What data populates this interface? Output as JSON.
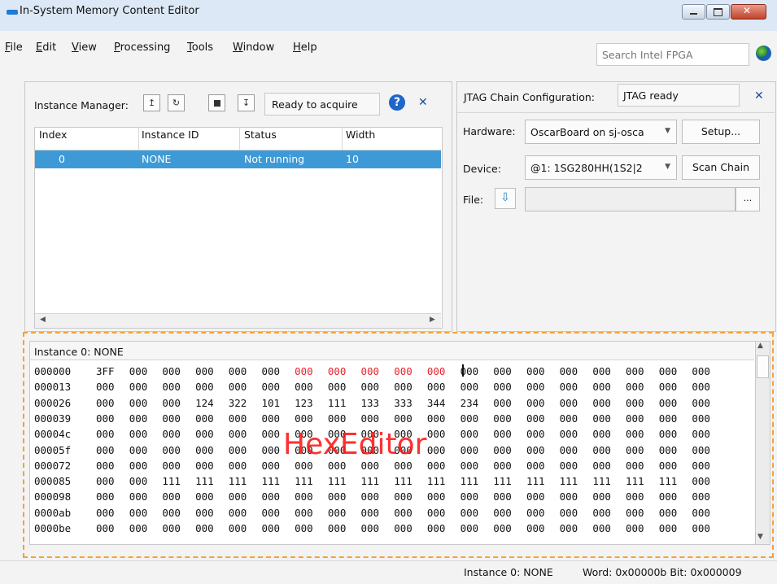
{
  "window": {
    "title": "In-System Memory Content Editor"
  },
  "menu": [
    "File",
    "Edit",
    "View",
    "Processing",
    "Tools",
    "Window",
    "Help"
  ],
  "search": {
    "placeholder": "Search Intel FPGA"
  },
  "instance_manager": {
    "label": "Instance Manager:",
    "status": "Ready to acquire",
    "help_glyph": "?",
    "close_glyph": "✕",
    "columns": [
      "Index",
      "Instance ID",
      "Status",
      "Width"
    ],
    "rows": [
      {
        "index": "0",
        "instance_id": "NONE",
        "status": "Not running",
        "width": "10"
      }
    ]
  },
  "jtag": {
    "label": "JTAG Chain Configuration:",
    "status": "JTAG ready",
    "close_glyph": "✕",
    "hardware_label": "Hardware:",
    "hardware_value": "OscarBoard on sj-osca",
    "setup_label": "Setup...",
    "device_label": "Device:",
    "device_value": "@1: 1SG280HH(1S2|2",
    "scan_chain_label": "Scan Chain",
    "file_label": "File:",
    "browse_label": "..."
  },
  "hex_editor": {
    "title": "Instance 0: NONE",
    "overlay_label": "HexEditor",
    "rows": [
      {
        "addr": "000000",
        "values": [
          "3FF",
          "000",
          "000",
          "000",
          "000",
          "000",
          "000",
          "000",
          "000",
          "000",
          "000",
          "000",
          "000",
          "000",
          "000",
          "000",
          "000",
          "000",
          "000"
        ],
        "highlight": [
          6,
          7,
          8,
          9,
          10
        ]
      },
      {
        "addr": "000013",
        "values": [
          "000",
          "000",
          "000",
          "000",
          "000",
          "000",
          "000",
          "000",
          "000",
          "000",
          "000",
          "000",
          "000",
          "000",
          "000",
          "000",
          "000",
          "000",
          "000"
        ],
        "highlight": []
      },
      {
        "addr": "000026",
        "values": [
          "000",
          "000",
          "000",
          "124",
          "322",
          "101",
          "123",
          "111",
          "133",
          "333",
          "344",
          "234",
          "000",
          "000",
          "000",
          "000",
          "000",
          "000",
          "000"
        ],
        "highlight": []
      },
      {
        "addr": "000039",
        "values": [
          "000",
          "000",
          "000",
          "000",
          "000",
          "000",
          "000",
          "000",
          "000",
          "000",
          "000",
          "000",
          "000",
          "000",
          "000",
          "000",
          "000",
          "000",
          "000"
        ],
        "highlight": []
      },
      {
        "addr": "00004c",
        "values": [
          "000",
          "000",
          "000",
          "000",
          "000",
          "000",
          "000",
          "000",
          "000",
          "000",
          "000",
          "000",
          "000",
          "000",
          "000",
          "000",
          "000",
          "000",
          "000"
        ],
        "highlight": []
      },
      {
        "addr": "00005f",
        "values": [
          "000",
          "000",
          "000",
          "000",
          "000",
          "000",
          "000",
          "000",
          "000",
          "000",
          "000",
          "000",
          "000",
          "000",
          "000",
          "000",
          "000",
          "000",
          "000"
        ],
        "highlight": []
      },
      {
        "addr": "000072",
        "values": [
          "000",
          "000",
          "000",
          "000",
          "000",
          "000",
          "000",
          "000",
          "000",
          "000",
          "000",
          "000",
          "000",
          "000",
          "000",
          "000",
          "000",
          "000",
          "000"
        ],
        "highlight": []
      },
      {
        "addr": "000085",
        "values": [
          "000",
          "000",
          "111",
          "111",
          "111",
          "111",
          "111",
          "111",
          "111",
          "111",
          "111",
          "111",
          "111",
          "111",
          "111",
          "111",
          "111",
          "111",
          "000"
        ],
        "highlight": []
      },
      {
        "addr": "000098",
        "values": [
          "000",
          "000",
          "000",
          "000",
          "000",
          "000",
          "000",
          "000",
          "000",
          "000",
          "000",
          "000",
          "000",
          "000",
          "000",
          "000",
          "000",
          "000",
          "000"
        ],
        "highlight": []
      },
      {
        "addr": "0000ab",
        "values": [
          "000",
          "000",
          "000",
          "000",
          "000",
          "000",
          "000",
          "000",
          "000",
          "000",
          "000",
          "000",
          "000",
          "000",
          "000",
          "000",
          "000",
          "000",
          "000"
        ],
        "highlight": []
      },
      {
        "addr": "0000be",
        "values": [
          "000",
          "000",
          "000",
          "000",
          "000",
          "000",
          "000",
          "000",
          "000",
          "000",
          "000",
          "000",
          "000",
          "000",
          "000",
          "000",
          "000",
          "000",
          "000"
        ],
        "highlight": []
      }
    ]
  },
  "status_bar": {
    "instance": "Instance 0: NONE",
    "word_bit": "Word: 0x00000b  Bit: 0x000009"
  },
  "colors": {
    "selection": "#3d9ad6",
    "highlight_text": "#e8242c",
    "dashed_border": "#f2a23a",
    "overlay_text": "#ff1a1a"
  }
}
